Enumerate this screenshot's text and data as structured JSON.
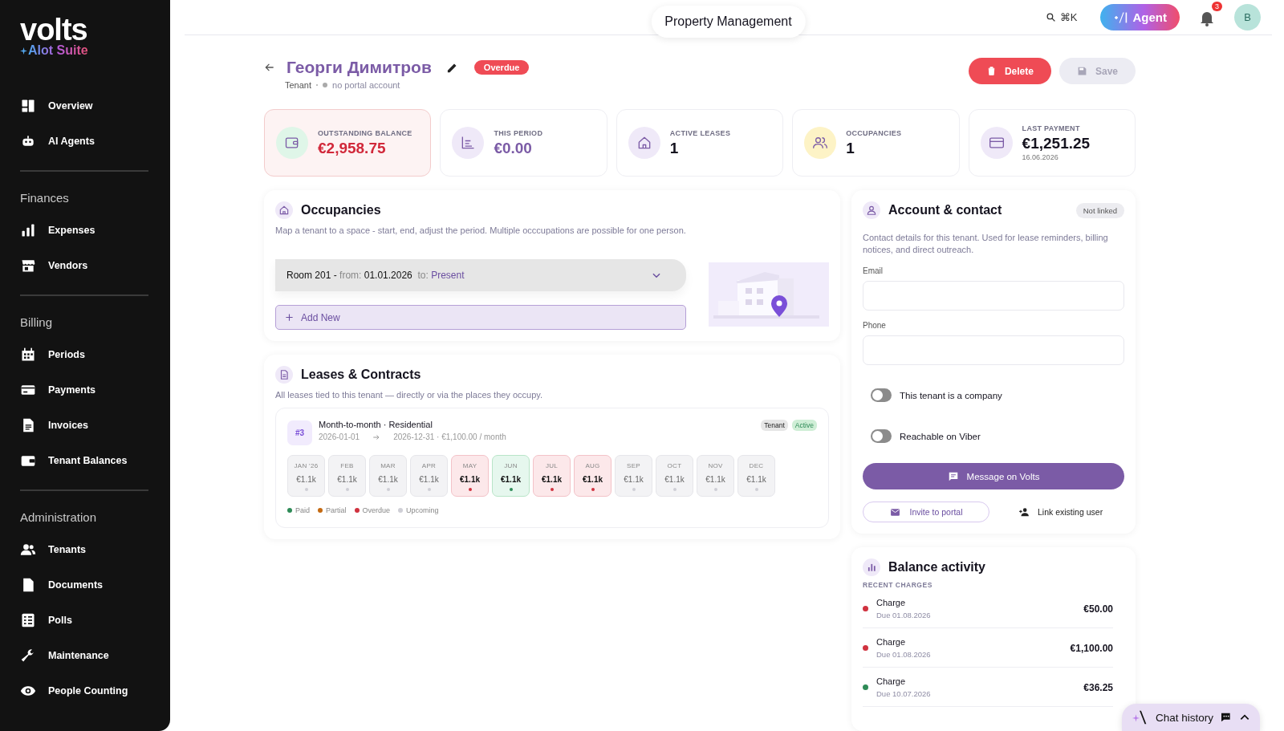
{
  "sidebar": {
    "logo": {
      "name": "volts",
      "suite": "AIot Suite"
    },
    "groups": [
      {
        "items": [
          {
            "kind": "dashboard",
            "label": "Overview"
          },
          {
            "kind": "robot",
            "label": "AI Agents"
          }
        ]
      },
      {
        "heading": "Finances",
        "items": [
          {
            "kind": "bars",
            "label": "Expenses"
          },
          {
            "kind": "store",
            "label": "Vendors"
          }
        ]
      },
      {
        "heading": "Billing",
        "items": [
          {
            "kind": "calendar",
            "label": "Periods"
          },
          {
            "kind": "card",
            "label": "Payments"
          },
          {
            "kind": "doc",
            "label": "Invoices"
          },
          {
            "kind": "wallet",
            "label": "Tenant Balances"
          }
        ]
      },
      {
        "heading": "Administration",
        "items": [
          {
            "kind": "people",
            "label": "Tenants"
          },
          {
            "kind": "file",
            "label": "Documents"
          },
          {
            "kind": "checklist",
            "label": "Polls"
          },
          {
            "kind": "wrench",
            "label": "Maintenance"
          },
          {
            "kind": "eye",
            "label": "People Counting"
          }
        ]
      }
    ]
  },
  "header": {
    "title": "Property Management",
    "search_shortcut": "⌘K",
    "agent_button": "Agent",
    "notifications": "3",
    "avatar": "B"
  },
  "tenant": {
    "name": "Георги Димитров",
    "status": "Overdue",
    "role": "Tenant",
    "portal": "no portal account",
    "delete": "Delete",
    "save": "Save",
    "save_disabled": true
  },
  "stats": [
    {
      "kind": "balance",
      "label": "OUTSTANDING BALANCE",
      "value": "€2,958.75"
    },
    {
      "kind": "period",
      "label": "THIS PERIOD",
      "value": "€0.00"
    },
    {
      "kind": "leases",
      "label": "ACTIVE LEASES",
      "value": "1"
    },
    {
      "kind": "occupancies",
      "label": "OCCUPANCIES",
      "value": "1"
    },
    {
      "kind": "payment",
      "label": "LAST PAYMENT",
      "value": "€1,251.25",
      "sub": "16.06.2026"
    }
  ],
  "occupancies": {
    "title": "Occupancies",
    "description": "Map a tenant to a space - start, end, adjust the period. Multiple occcupations are possible for one person.",
    "rows": [
      {
        "room": "Room 201 -",
        "from_label": "from:",
        "from": "01.01.2026",
        "to_label": "to:",
        "to": "Present"
      }
    ],
    "add": "Add New"
  },
  "leases": {
    "title": "Leases & Contracts",
    "description": "All leases tied to this tenant — directly or via the places they occupy.",
    "items": [
      {
        "number": "#3",
        "title": "Month-to-month · Residential",
        "start": "2026-01-01",
        "end": "2026-12-31 · €1,100.00 / month",
        "tags": [
          {
            "label": "Tenant",
            "kind": "role"
          },
          {
            "label": "Active",
            "kind": "status"
          }
        ],
        "months": [
          {
            "label": "JAN '26",
            "amount": "€1.1k",
            "kind": "upcoming"
          },
          {
            "label": "FEB",
            "amount": "€1.1k",
            "kind": "upcoming"
          },
          {
            "label": "MAR",
            "amount": "€1.1k",
            "kind": "upcoming"
          },
          {
            "label": "APR",
            "amount": "€1.1k",
            "kind": "upcoming"
          },
          {
            "label": "MAY",
            "amount": "€1.1k",
            "kind": "overdue"
          },
          {
            "label": "JUN",
            "amount": "€1.1k",
            "kind": "paid"
          },
          {
            "label": "JUL",
            "amount": "€1.1k",
            "kind": "overdue"
          },
          {
            "label": "AUG",
            "amount": "€1.1k",
            "kind": "overdue"
          },
          {
            "label": "SEP",
            "amount": "€1.1k",
            "kind": "upcoming"
          },
          {
            "label": "OCT",
            "amount": "€1.1k",
            "kind": "upcoming"
          },
          {
            "label": "NOV",
            "amount": "€1.1k",
            "kind": "upcoming"
          },
          {
            "label": "DEC",
            "amount": "€1.1k",
            "kind": "upcoming"
          }
        ]
      }
    ],
    "legend": [
      {
        "label": "Paid",
        "color": "#2e8b57"
      },
      {
        "label": "Partial",
        "color": "#c46a12"
      },
      {
        "label": "Overdue",
        "color": "#d0323f"
      },
      {
        "label": "Upcoming",
        "color": "#cfcfd6"
      }
    ]
  },
  "account": {
    "title": "Account & contact",
    "badge": "Not linked",
    "description": "Contact details for this tenant. Used for lease reminders, billing notices, and direct outreach.",
    "fields": [
      {
        "label": "Email"
      },
      {
        "label": "Phone"
      }
    ],
    "toggles": [
      {
        "label": "This tenant is a company",
        "on": false
      },
      {
        "label": "Reachable on Viber",
        "on": false
      }
    ],
    "message": "Message on Volts",
    "invite": "Invite to portal",
    "link": "Link existing user"
  },
  "balance": {
    "title": "Balance activity",
    "subtitle": "RECENT CHARGES",
    "rows": [
      {
        "title": "Charge",
        "due": "Due 01.08.2026",
        "amount": "€50.00",
        "color": "#d0323f"
      },
      {
        "title": "Charge",
        "due": "Due 01.08.2026",
        "amount": "€1,100.00",
        "color": "#d0323f"
      },
      {
        "title": "Charge",
        "due": "Due 10.07.2026",
        "amount": "€36.25",
        "color": "#2e8b57"
      }
    ]
  },
  "chat": {
    "label": "Chat history"
  }
}
